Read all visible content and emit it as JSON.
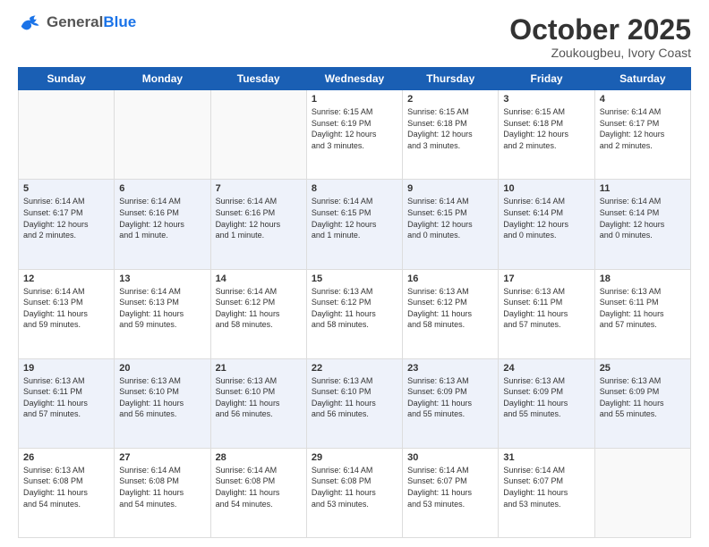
{
  "header": {
    "logo_general": "General",
    "logo_blue": "Blue",
    "month_title": "October 2025",
    "location": "Zoukougbeu, Ivory Coast"
  },
  "days_of_week": [
    "Sunday",
    "Monday",
    "Tuesday",
    "Wednesday",
    "Thursday",
    "Friday",
    "Saturday"
  ],
  "weeks": [
    [
      {
        "num": "",
        "info": ""
      },
      {
        "num": "",
        "info": ""
      },
      {
        "num": "",
        "info": ""
      },
      {
        "num": "1",
        "info": "Sunrise: 6:15 AM\nSunset: 6:19 PM\nDaylight: 12 hours\nand 3 minutes."
      },
      {
        "num": "2",
        "info": "Sunrise: 6:15 AM\nSunset: 6:18 PM\nDaylight: 12 hours\nand 3 minutes."
      },
      {
        "num": "3",
        "info": "Sunrise: 6:15 AM\nSunset: 6:18 PM\nDaylight: 12 hours\nand 2 minutes."
      },
      {
        "num": "4",
        "info": "Sunrise: 6:14 AM\nSunset: 6:17 PM\nDaylight: 12 hours\nand 2 minutes."
      }
    ],
    [
      {
        "num": "5",
        "info": "Sunrise: 6:14 AM\nSunset: 6:17 PM\nDaylight: 12 hours\nand 2 minutes."
      },
      {
        "num": "6",
        "info": "Sunrise: 6:14 AM\nSunset: 6:16 PM\nDaylight: 12 hours\nand 1 minute."
      },
      {
        "num": "7",
        "info": "Sunrise: 6:14 AM\nSunset: 6:16 PM\nDaylight: 12 hours\nand 1 minute."
      },
      {
        "num": "8",
        "info": "Sunrise: 6:14 AM\nSunset: 6:15 PM\nDaylight: 12 hours\nand 1 minute."
      },
      {
        "num": "9",
        "info": "Sunrise: 6:14 AM\nSunset: 6:15 PM\nDaylight: 12 hours\nand 0 minutes."
      },
      {
        "num": "10",
        "info": "Sunrise: 6:14 AM\nSunset: 6:14 PM\nDaylight: 12 hours\nand 0 minutes."
      },
      {
        "num": "11",
        "info": "Sunrise: 6:14 AM\nSunset: 6:14 PM\nDaylight: 12 hours\nand 0 minutes."
      }
    ],
    [
      {
        "num": "12",
        "info": "Sunrise: 6:14 AM\nSunset: 6:13 PM\nDaylight: 11 hours\nand 59 minutes."
      },
      {
        "num": "13",
        "info": "Sunrise: 6:14 AM\nSunset: 6:13 PM\nDaylight: 11 hours\nand 59 minutes."
      },
      {
        "num": "14",
        "info": "Sunrise: 6:14 AM\nSunset: 6:12 PM\nDaylight: 11 hours\nand 58 minutes."
      },
      {
        "num": "15",
        "info": "Sunrise: 6:13 AM\nSunset: 6:12 PM\nDaylight: 11 hours\nand 58 minutes."
      },
      {
        "num": "16",
        "info": "Sunrise: 6:13 AM\nSunset: 6:12 PM\nDaylight: 11 hours\nand 58 minutes."
      },
      {
        "num": "17",
        "info": "Sunrise: 6:13 AM\nSunset: 6:11 PM\nDaylight: 11 hours\nand 57 minutes."
      },
      {
        "num": "18",
        "info": "Sunrise: 6:13 AM\nSunset: 6:11 PM\nDaylight: 11 hours\nand 57 minutes."
      }
    ],
    [
      {
        "num": "19",
        "info": "Sunrise: 6:13 AM\nSunset: 6:11 PM\nDaylight: 11 hours\nand 57 minutes."
      },
      {
        "num": "20",
        "info": "Sunrise: 6:13 AM\nSunset: 6:10 PM\nDaylight: 11 hours\nand 56 minutes."
      },
      {
        "num": "21",
        "info": "Sunrise: 6:13 AM\nSunset: 6:10 PM\nDaylight: 11 hours\nand 56 minutes."
      },
      {
        "num": "22",
        "info": "Sunrise: 6:13 AM\nSunset: 6:10 PM\nDaylight: 11 hours\nand 56 minutes."
      },
      {
        "num": "23",
        "info": "Sunrise: 6:13 AM\nSunset: 6:09 PM\nDaylight: 11 hours\nand 55 minutes."
      },
      {
        "num": "24",
        "info": "Sunrise: 6:13 AM\nSunset: 6:09 PM\nDaylight: 11 hours\nand 55 minutes."
      },
      {
        "num": "25",
        "info": "Sunrise: 6:13 AM\nSunset: 6:09 PM\nDaylight: 11 hours\nand 55 minutes."
      }
    ],
    [
      {
        "num": "26",
        "info": "Sunrise: 6:13 AM\nSunset: 6:08 PM\nDaylight: 11 hours\nand 54 minutes."
      },
      {
        "num": "27",
        "info": "Sunrise: 6:14 AM\nSunset: 6:08 PM\nDaylight: 11 hours\nand 54 minutes."
      },
      {
        "num": "28",
        "info": "Sunrise: 6:14 AM\nSunset: 6:08 PM\nDaylight: 11 hours\nand 54 minutes."
      },
      {
        "num": "29",
        "info": "Sunrise: 6:14 AM\nSunset: 6:08 PM\nDaylight: 11 hours\nand 53 minutes."
      },
      {
        "num": "30",
        "info": "Sunrise: 6:14 AM\nSunset: 6:07 PM\nDaylight: 11 hours\nand 53 minutes."
      },
      {
        "num": "31",
        "info": "Sunrise: 6:14 AM\nSunset: 6:07 PM\nDaylight: 11 hours\nand 53 minutes."
      },
      {
        "num": "",
        "info": ""
      }
    ]
  ]
}
